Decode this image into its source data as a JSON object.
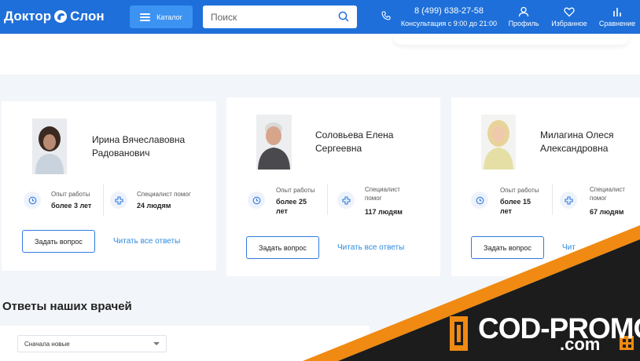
{
  "header": {
    "logo_text_1": "Доктор",
    "logo_text_2": "Слон",
    "catalog_label": "Каталог",
    "search_placeholder": "Поиск",
    "phone": "8 (499) 638-27-58",
    "consult_hours": "Консультация с 9:00 до 21:00",
    "nav": [
      {
        "label": "Профиль",
        "icon": "user-icon"
      },
      {
        "label": "Избранное",
        "icon": "heart-icon"
      },
      {
        "label": "Сравнение",
        "icon": "compare-icon"
      }
    ]
  },
  "doctors": [
    {
      "name_line1": "Ирина Вячеславовна",
      "name_line2": "Радованович",
      "exp_label": "Опыт работы",
      "exp_value": "более 3 лет",
      "help_label": "Специалист помог",
      "help_value": "24 людям",
      "ask_label": "Задать вопрос",
      "read_label": "Читать все ответы"
    },
    {
      "name_line1": "Соловьева Елена",
      "name_line2": "Сергеевна",
      "exp_label": "Опыт работы",
      "exp_value_1": "более 25",
      "exp_value_2": "лет",
      "help_label_1": "Специалист",
      "help_label_2": "помог",
      "help_value": "117 людям",
      "ask_label": "Задать вопрос",
      "read_label": "Читать все ответы"
    },
    {
      "name_line1": "Милагина Олеся",
      "name_line2": "Александровна",
      "exp_label": "Опыт работы",
      "exp_value_1": "более 15",
      "exp_value_2": "лет",
      "help_label_1": "Специалист",
      "help_label_2": "помог",
      "help_value": "67 людям",
      "ask_label": "Задать вопрос",
      "read_label": "Чит"
    }
  ],
  "answers": {
    "title": "Ответы наших врачей",
    "sort_value": "Сначала новые"
  },
  "promo": {
    "text": "COD-PROMO",
    "domain": ".com"
  },
  "colors": {
    "header": "#1e6fd9",
    "catalog": "#3d93f2",
    "link": "#2f8be0",
    "promo_dark": "#1c1c1c",
    "promo_orange": "#f08a12"
  }
}
